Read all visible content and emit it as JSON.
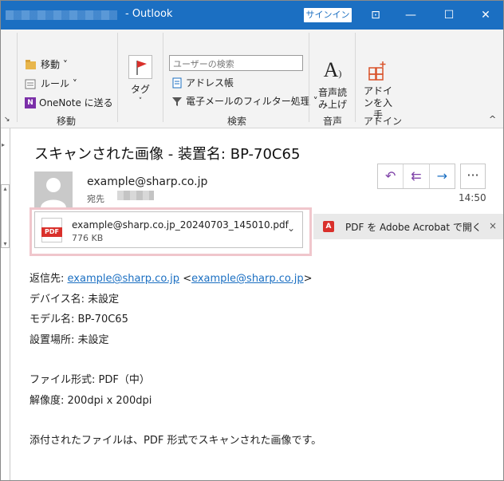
{
  "titlebar": {
    "title": "- Outlook",
    "signin": "サインイン",
    "controls": {
      "ribbon_display": "⊡",
      "minimize": "—",
      "maximize": "☐",
      "close": "✕"
    }
  },
  "ribbon": {
    "move_group": {
      "label": "移動",
      "items": [
        "移動 ˅",
        "ルール ˅",
        "OneNote に送る"
      ]
    },
    "tags": {
      "label": "タグ"
    },
    "search_group": {
      "label": "検索",
      "placeholder": "ユーザーの検索",
      "address_book": "アドレス帳",
      "filter_email": "電子メールのフィルター処理 ˅"
    },
    "voice_group": {
      "label": "音声",
      "read_aloud": "音声読み上げ"
    },
    "addins_group": {
      "label": "アドイン",
      "get_addins": "アドインを入手"
    },
    "collapse": "^"
  },
  "message": {
    "subject": "スキャンされた画像 - 装置名: BP-70C65",
    "sender": "example@sharp.co.jp",
    "to_label": "宛先",
    "time": "14:50",
    "actions": {
      "reply": "↶",
      "reply_all": "⇇",
      "forward": "→",
      "more": "···"
    },
    "attachment": {
      "name": "example@sharp.co.jp_20240703_145010.pdf",
      "size": "776 KB",
      "badge": "PDF"
    },
    "acrobat_bar": {
      "text": "PDF を Adobe Acrobat で開く",
      "close": "×"
    },
    "body": {
      "reply_to_label": "返信先: ",
      "reply_to_link1": "example@sharp.co.jp",
      "reply_to_open": "<",
      "reply_to_link2": "example@sharp.co.jp",
      "reply_to_close": ">",
      "device_name": "デバイス名: 未設定",
      "model_name": "モデル名: BP-70C65",
      "location": "設置場所: 未設定",
      "file_format": "ファイル形式: PDF（中）",
      "resolution": "解像度: 200dpi x 200dpi",
      "note": "添付されたファイルは、PDF 形式でスキャンされた画像です。"
    }
  }
}
